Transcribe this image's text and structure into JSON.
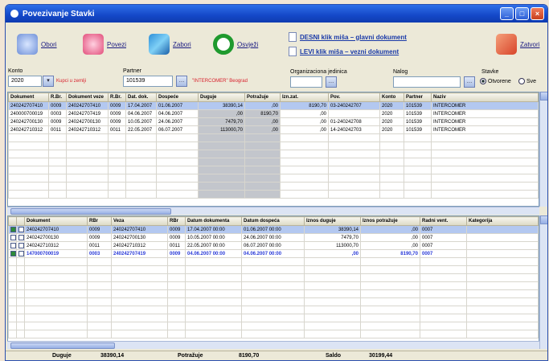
{
  "window": {
    "title": "Povezivanje Stavki"
  },
  "toolbar": {
    "buttons": [
      {
        "label": "Obori",
        "icon": "sync-icon"
      },
      {
        "label": "Povezi",
        "icon": "link-icon"
      },
      {
        "label": "Zabori",
        "icon": "books-icon"
      },
      {
        "label": "Osvježi",
        "icon": "refresh-icon"
      }
    ],
    "doc_main": "DESNI klik miša – glavni dokument",
    "doc_linked": "LEVI klik miša – vezni dokument",
    "close_label": "Zatvori"
  },
  "filters": {
    "konto_label": "Konto",
    "konto_value": "2020",
    "partner_label": "Partner",
    "partner_value": "101539",
    "konto_red_text": "Kupci u zemlji",
    "partner_red_text": "\"INTERCOMER\" Beograd",
    "org_label": "Organizaciona jedinica",
    "nalog_label": "Nalog",
    "stavke_label": "Stavke",
    "radio_otvorene": "Otvorene",
    "radio_sve": "Sve"
  },
  "upper_grid": {
    "columns": [
      "Dokument",
      "R.Br.",
      "Dokument veze",
      "R.Br.",
      "Dat. dok.",
      "Dospeće",
      "Duguje",
      "Potražuje",
      "Izn.zat.",
      "Pov.",
      "Konto",
      "Partner",
      "Naziv"
    ],
    "rows": [
      [
        "240242707410",
        "0009",
        "240242707410",
        "0009",
        "17.04.2007",
        "01.06.2007",
        "38390,14",
        ",00",
        "8190,70",
        "03-240242707",
        "2020",
        "101539",
        "INTERCOMER"
      ],
      [
        "240000700019",
        "0003",
        "240242707419",
        "0009",
        "04.06.2007",
        "04.06.2007",
        ",00",
        "8190,70",
        ",00",
        "",
        "2020",
        "101539",
        "INTERCOMER"
      ],
      [
        "240242700130",
        "0009",
        "240242700130",
        "0009",
        "10.05.2007",
        "24.06.2007",
        "7479,70",
        ",00",
        ",00",
        "01-240242708",
        "2020",
        "101539",
        "INTERCOMER"
      ],
      [
        "240242710312",
        "0011",
        "240242710312",
        "0011",
        "22.05.2007",
        "06.07.2007",
        "113000,70",
        ",00",
        ",00",
        "14-240242703",
        "2020",
        "101539",
        "INTERCOMER"
      ]
    ]
  },
  "lower_grid": {
    "columns": [
      "Dokument",
      "RBr",
      "Veza",
      "RBr",
      "Datum dokumenta",
      "Datum dospeća",
      "Iznos duguje",
      "Iznos potražuje",
      "Radni vent.",
      "Kategorija"
    ],
    "rows": [
      {
        "check1": true,
        "check2": false,
        "cells": [
          "240242707410",
          "0009",
          "240242707410",
          "0009",
          "17.04.2007 00:00",
          "01.06.2007 00:00",
          "38390,14",
          ",00",
          "0007",
          ""
        ]
      },
      {
        "check1": false,
        "check2": false,
        "cells": [
          "240242700130",
          "0009",
          "240242700130",
          "0009",
          "10.05.2007 00:00",
          "24.06.2007 00:00",
          "7479,70",
          ",00",
          "0007",
          ""
        ]
      },
      {
        "check1": false,
        "check2": false,
        "cells": [
          "240242710312",
          "0011",
          "240242710312",
          "0011",
          "22.05.2007 00:00",
          "06.07.2007 00:00",
          "113000,70",
          ",00",
          "0007",
          ""
        ]
      },
      {
        "check1": true,
        "check2": false,
        "cells": [
          "147000700019",
          "0003",
          "240242707419",
          "0009",
          "04.06.2007 00:00",
          "04.06.2007 00:00",
          ",00",
          "8190,70",
          "0007",
          ""
        ]
      }
    ]
  },
  "status": {
    "duguje_label": "Duguje",
    "duguje_value": "38390,14",
    "potrazuje_label": "Potražuje",
    "potrazuje_value": "8190,70",
    "saldo_label": "Saldo",
    "saldo_value": "30199,44"
  }
}
